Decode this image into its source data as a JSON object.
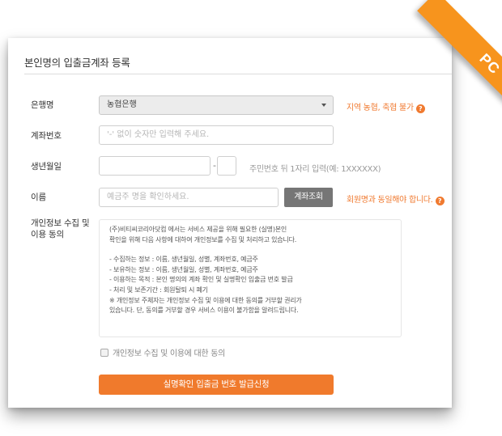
{
  "form": {
    "title": "본인명의 입출금계좌 등록",
    "bank": {
      "label": "은행명",
      "selected": "농협은행",
      "note": "지역 농협, 축협 불가"
    },
    "account": {
      "label": "계좌번호",
      "placeholder": "'-' 없이 숫자만 입력해 주세요."
    },
    "birth": {
      "label": "생년월일",
      "dash": "-",
      "note": "주민번호 뒤 1자리 입력(예: 1XXXXXX)"
    },
    "name": {
      "label": "이름",
      "placeholder": "예금주 명을 확인하세요.",
      "verify_button": "계좌조회",
      "note": "회원명과 동일해야 합니다."
    },
    "privacy": {
      "label_line1": "개인정보 수집 및",
      "label_line2": "이용 동의",
      "terms_lines": [
        "(주)비티씨코리아닷컴 에서는 서비스 제공을 위해 필요한 (실명)본인",
        "확인을 위해 다음 사항에 대하여 개인정보를 수집 및 처리하고 있습니다."
      ],
      "terms_list": [
        "- 수집하는 정보 : 이름, 생년월일, 성별, 계좌번호, 예금주",
        "- 보유하는 정보 : 이름, 생년월일, 성별, 계좌번호, 예금주",
        "- 이용하는 목적 : 본인 명의의 계좌 확인 및 실명확인 입출금 번호 발급",
        "- 처리 및 보존기간 : 회원탈퇴 시 폐기",
        "※ 개인정보 주체자는 개인정보 수집 및 이용에 대한 동의를 거부할 권리가",
        "있습니다. 단, 동의를 거부할 경우 서비스 이용이 불가함을 알려드립니다."
      ],
      "agree_label": "개인정보 수집 및 이용에 대한 동의",
      "agree_checked": false
    },
    "submit_button": "실명확인 입출금 번호 발급신청"
  },
  "ribbon": {
    "text": "PC",
    "color": "#f7941d"
  },
  "colors": {
    "accent": "#f07a2c",
    "verify_button": "#767676"
  }
}
